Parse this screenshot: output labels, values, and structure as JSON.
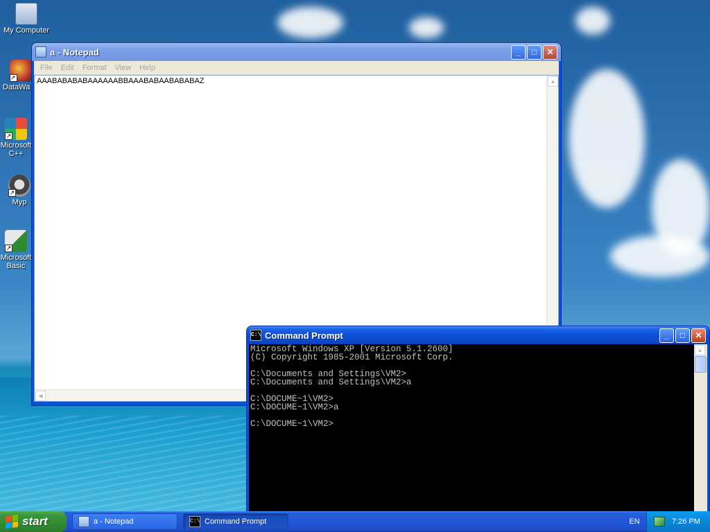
{
  "desktop": {
    "icons": [
      {
        "label": "My Computer"
      },
      {
        "label": "DataWa"
      },
      {
        "label": "Microsoft C++"
      },
      {
        "label": "Myp"
      },
      {
        "label": "Microsoft Basic"
      }
    ]
  },
  "notepad": {
    "title": "a - Notepad",
    "menu": [
      "File",
      "Edit",
      "Format",
      "View",
      "Help"
    ],
    "content": "AAABABABABAAAAAABBAAABABAABABABAZ",
    "buttons": {
      "minimize": "_",
      "maximize": "□",
      "close": "✕"
    }
  },
  "cmd": {
    "title": "Command Prompt",
    "icon_text": "C:\\",
    "lines": [
      "Microsoft Windows XP [Version 5.1.2600]",
      "(C) Copyright 1985-2001 Microsoft Corp.",
      "",
      "C:\\Documents and Settings\\VM2>",
      "C:\\Documents and Settings\\VM2>a",
      "",
      "C:\\DOCUME~1\\VM2>",
      "C:\\DOCUME~1\\VM2>a",
      "",
      "C:\\DOCUME~1\\VM2>"
    ],
    "buttons": {
      "minimize": "_",
      "maximize": "□",
      "close": "✕"
    }
  },
  "taskbar": {
    "start_label": "start",
    "tasks": [
      {
        "label": "a - Notepad"
      },
      {
        "label": "Command Prompt"
      }
    ],
    "language": "EN",
    "clock": "7:26 PM"
  },
  "colors": {
    "titlebar_active": "#0a4fd8",
    "start_green": "#318731",
    "console_bg": "#000000",
    "console_fg": "#c0c0c0"
  }
}
